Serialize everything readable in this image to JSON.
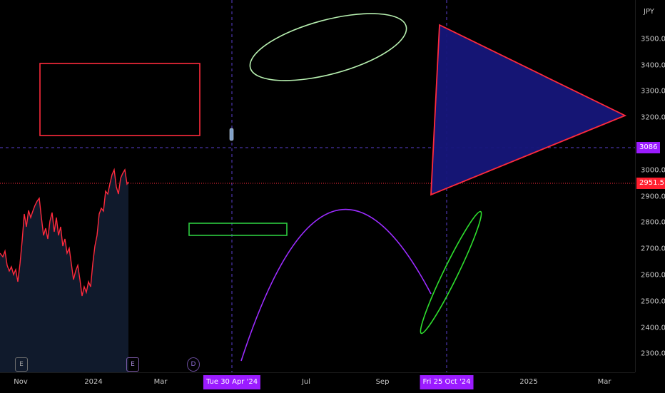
{
  "price_scale": {
    "currency": "JPY",
    "ticks": [
      "3500.0",
      "3400.0",
      "3300.0",
      "3200.0",
      "3100.0",
      "3000.0",
      "2900.0",
      "2800.0",
      "2700.0",
      "2600.0",
      "2500.0",
      "2400.0",
      "2300.0"
    ],
    "crosshair_price": "3086",
    "last_price": "2951.5"
  },
  "time_scale": {
    "ticks": [
      "Nov",
      "2024",
      "Mar",
      "Jul",
      "Sep",
      "2025",
      "Mar"
    ],
    "crosshair_date_1": "Tue 30 Apr '24",
    "crosshair_date_2": "Fri 25 Oct '24"
  },
  "events": [
    {
      "icon": "earnings-icon",
      "label": "E"
    },
    {
      "icon": "earnings-icon",
      "label": "E"
    },
    {
      "icon": "dividend-icon",
      "label": "D"
    }
  ],
  "colors": {
    "series": "#ff2a3d",
    "area_fill": "#101a2c",
    "crosshair": "#5a3fd0",
    "last_price_line": "#ff2a3d",
    "badge_crosshair": "#9b1bff",
    "badge_last": "#ff1f2f",
    "rect_red": "#ff2a3d",
    "rect_green": "#2ecc40",
    "ellipse_mint": "#b7f0b0",
    "triangle_stroke": "#ff2a3d",
    "triangle_fill": "#16167a",
    "arc": "#9b2cff",
    "ellipse_green": "#2ee02e"
  }
}
